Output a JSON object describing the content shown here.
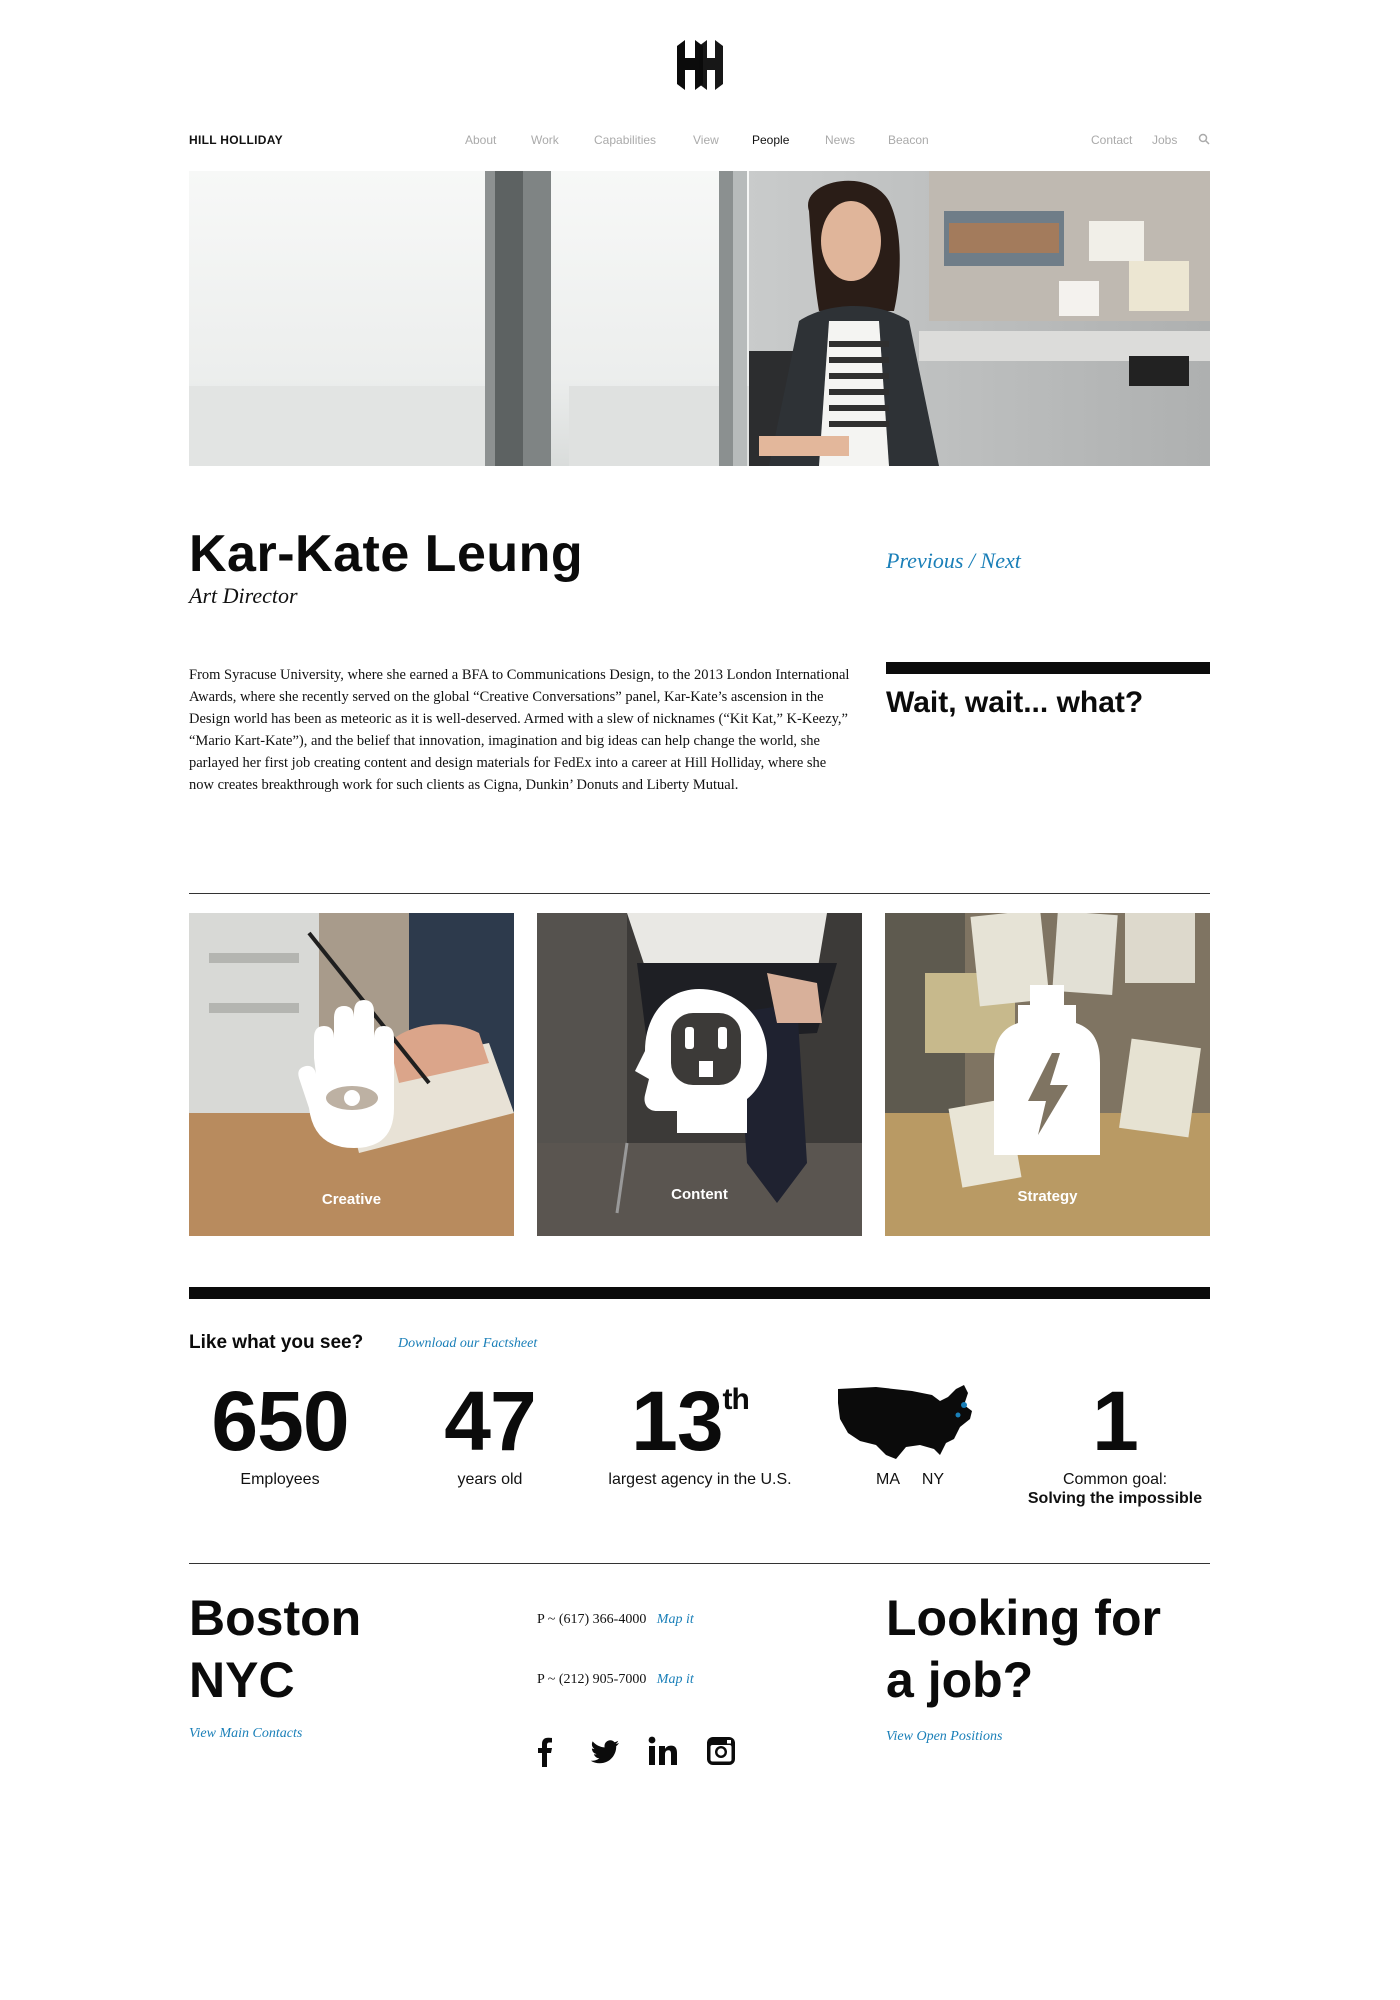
{
  "brand": "HILL HOLLIDAY",
  "nav": {
    "items": [
      "About",
      "Work",
      "Capabilities",
      "View",
      "People",
      "News",
      "Beacon"
    ],
    "right": [
      "Contact",
      "Jobs"
    ]
  },
  "profile": {
    "name": "Kar-Kate Leung",
    "title": "Art Director",
    "previous": "Previous",
    "separator": "/",
    "next": "Next",
    "bio": "From Syracuse University, where she earned a BFA to Communications Design, to the 2013 London International Awards, where she recently served on the global “Creative Conversations” panel, Kar-Kate’s ascension in the Design world has been as meteoric as it is well-deserved. Armed with a slew of nicknames (“Kit Kat,” K-Keezy,” “Mario Kart-Kate”), and the belief that innovation, imagination and big ideas can help change the world, she parlayed her first job creating content and design materials for FedEx into a career at Hill Holliday, where she now creates breakthrough work for such clients as Cigna, Dunkin’ Donuts and Liberty Mutual.",
    "quote": "Wait, wait... what?"
  },
  "tiles": [
    {
      "label": "Creative",
      "icon": "hand-eye-icon"
    },
    {
      "label": "Content",
      "icon": "head-outlet-icon"
    },
    {
      "label": "Strategy",
      "icon": "bottle-bolt-icon"
    }
  ],
  "facts": {
    "heading": "Like what you see?",
    "download": "Download our Factsheet",
    "employees": {
      "value": "650",
      "label": "Employees"
    },
    "years": {
      "value": "47",
      "label": "years old"
    },
    "rank": {
      "value": "13",
      "suffix": "th",
      "label": "largest agency in the U.S."
    },
    "map": {
      "left": "MA",
      "right": "NY"
    },
    "goal": {
      "value": "1",
      "label": "Common goal:",
      "sub": "Solving the impossible"
    }
  },
  "footer": {
    "city1": "Boston",
    "city2": "NYC",
    "main_contacts": "View Main Contacts",
    "phone1": "P ~ (617) 366-4000",
    "phone2": "P ~ (212) 905-7000",
    "map_it": "Map it",
    "job_line1": "Looking for",
    "job_line2": "a job?",
    "open_positions": "View Open Positions"
  },
  "colors": {
    "accent": "#1a7fb8",
    "text": "#0b0b0b",
    "nav_muted": "#aaaaaa"
  }
}
